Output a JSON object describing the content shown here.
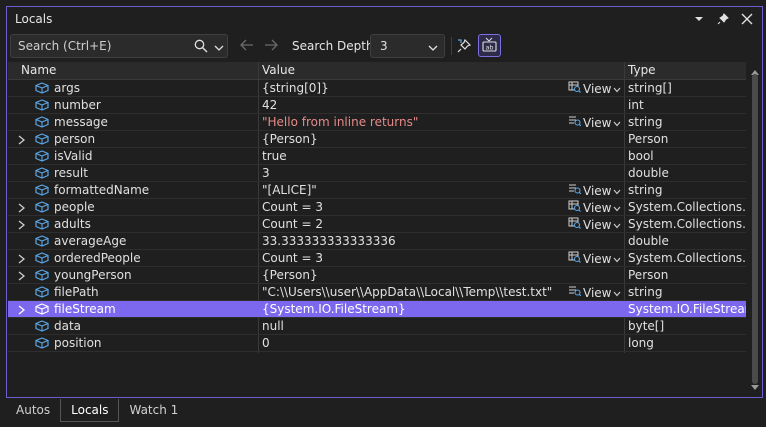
{
  "window": {
    "title": "Locals"
  },
  "toolbar": {
    "search_placeholder": "Search (Ctrl+E)",
    "depth_label": "Search Depth:",
    "depth_value": "3"
  },
  "columns": {
    "name": "Name",
    "value": "Value",
    "type": "Type"
  },
  "view_label": "View",
  "rows": [
    {
      "name": "args",
      "value": "{string[0]}",
      "type": "string[]",
      "expandable": false,
      "view": "grid",
      "string": false,
      "selected": false
    },
    {
      "name": "number",
      "value": "42",
      "type": "int",
      "expandable": false,
      "view": "",
      "string": false,
      "selected": false
    },
    {
      "name": "message",
      "value": "\"Hello from inline returns\"",
      "type": "string",
      "expandable": false,
      "view": "text",
      "string": true,
      "selected": false
    },
    {
      "name": "person",
      "value": "{Person}",
      "type": "Person",
      "expandable": true,
      "view": "",
      "string": false,
      "selected": false
    },
    {
      "name": "isValid",
      "value": "true",
      "type": "bool",
      "expandable": false,
      "view": "",
      "string": false,
      "selected": false
    },
    {
      "name": "result",
      "value": "3",
      "type": "double",
      "expandable": false,
      "view": "",
      "string": false,
      "selected": false
    },
    {
      "name": "formattedName",
      "value": "\"[ALICE]\"",
      "type": "string",
      "expandable": false,
      "view": "text",
      "string": false,
      "selected": false
    },
    {
      "name": "people",
      "value": "Count = 3",
      "type": "System.Collections....",
      "expandable": true,
      "view": "grid",
      "string": false,
      "selected": false
    },
    {
      "name": "adults",
      "value": "Count = 2",
      "type": "System.Collections....",
      "expandable": true,
      "view": "grid",
      "string": false,
      "selected": false
    },
    {
      "name": "averageAge",
      "value": "33.333333333333336",
      "type": "double",
      "expandable": false,
      "view": "",
      "string": false,
      "selected": false
    },
    {
      "name": "orderedPeople",
      "value": "Count = 3",
      "type": "System.Collections....",
      "expandable": true,
      "view": "grid",
      "string": false,
      "selected": false
    },
    {
      "name": "youngPerson",
      "value": "{Person}",
      "type": "Person",
      "expandable": true,
      "view": "",
      "string": false,
      "selected": false
    },
    {
      "name": "filePath",
      "value": "\"C:\\\\Users\\\\user\\\\AppData\\\\Local\\\\Temp\\\\test.txt\"",
      "type": "string",
      "expandable": false,
      "view": "text",
      "string": false,
      "selected": false
    },
    {
      "name": "fileStream",
      "value": "{System.IO.FileStream}",
      "type": "System.IO.FileStream",
      "expandable": true,
      "view": "",
      "string": false,
      "selected": true
    },
    {
      "name": "data",
      "value": "null",
      "type": "byte[]",
      "expandable": false,
      "view": "",
      "string": false,
      "selected": false
    },
    {
      "name": "position",
      "value": "0",
      "type": "long",
      "expandable": false,
      "view": "",
      "string": false,
      "selected": false
    }
  ],
  "tabs": [
    {
      "label": "Autos",
      "active": false
    },
    {
      "label": "Locals",
      "active": true
    },
    {
      "label": "Watch 1",
      "active": false
    }
  ],
  "colors": {
    "accent": "#7b68ee",
    "border": "#6b5fd0",
    "icon_blue": "#5aa6e6",
    "string_value": "#e58a8a"
  }
}
